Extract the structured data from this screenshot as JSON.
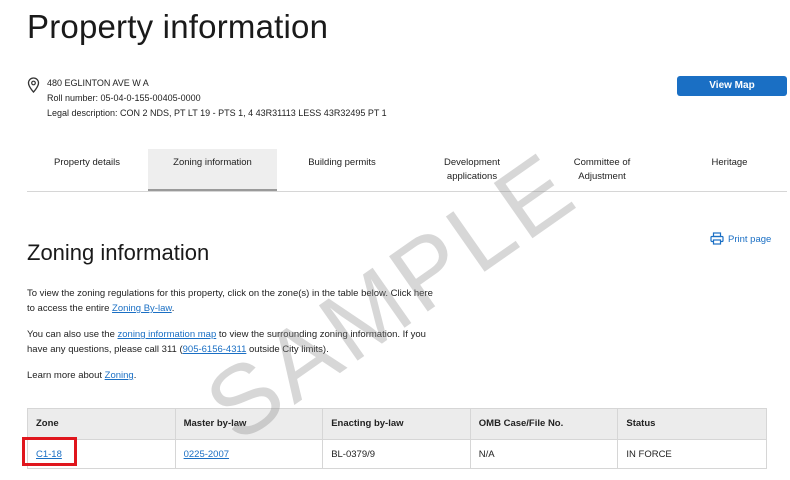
{
  "page": {
    "title": "Property information"
  },
  "property": {
    "address": "480 EGLINTON AVE W A",
    "roll_number": "Roll number: 05-04-0-155-00405-0000",
    "legal_description": "Legal description: CON 2 NDS, PT LT 19 - PTS 1, 4 43R31113 LESS 43R32495 PT 1"
  },
  "actions": {
    "view_map": "View Map",
    "print_page": "Print page"
  },
  "tabs": [
    {
      "label": "Property details"
    },
    {
      "label": "Zoning information",
      "active": true
    },
    {
      "label": "Building permits"
    },
    {
      "label_line1": "Development",
      "label_line2": "applications"
    },
    {
      "label_line1": "Committee of",
      "label_line2": "Adjustment"
    },
    {
      "label": "Heritage"
    }
  ],
  "zoning": {
    "heading": "Zoning information",
    "p1_a": "To view the zoning regulations for this property, click on the zone(s) in the table below. Click here",
    "p1_b": "to access the entire ",
    "p1_link": "Zoning By-law",
    "p1_c": ".",
    "p2_a": "You can also use the ",
    "p2_link": "zoning information map",
    "p2_b": " to view the surrounding zoning information. If you",
    "p2_c": "have any questions, please call 311 (",
    "p2_phone": "905-6156-4311",
    "p2_d": " outside City limits).",
    "p3_a": "Learn more about ",
    "p3_link": "Zoning",
    "p3_b": "."
  },
  "table": {
    "headers": [
      "Zone",
      "Master by-law",
      "Enacting by-law",
      "OMB Case/File No.",
      "Status"
    ],
    "rows": [
      [
        "C1-18",
        "0225-2007",
        "BL-0379/9",
        "N/A",
        "IN FORCE"
      ]
    ]
  },
  "watermark": "SAMPLE",
  "colors": {
    "link": "#1a6fc4",
    "highlight": "#e0161d",
    "button": "#1a6fc4"
  }
}
